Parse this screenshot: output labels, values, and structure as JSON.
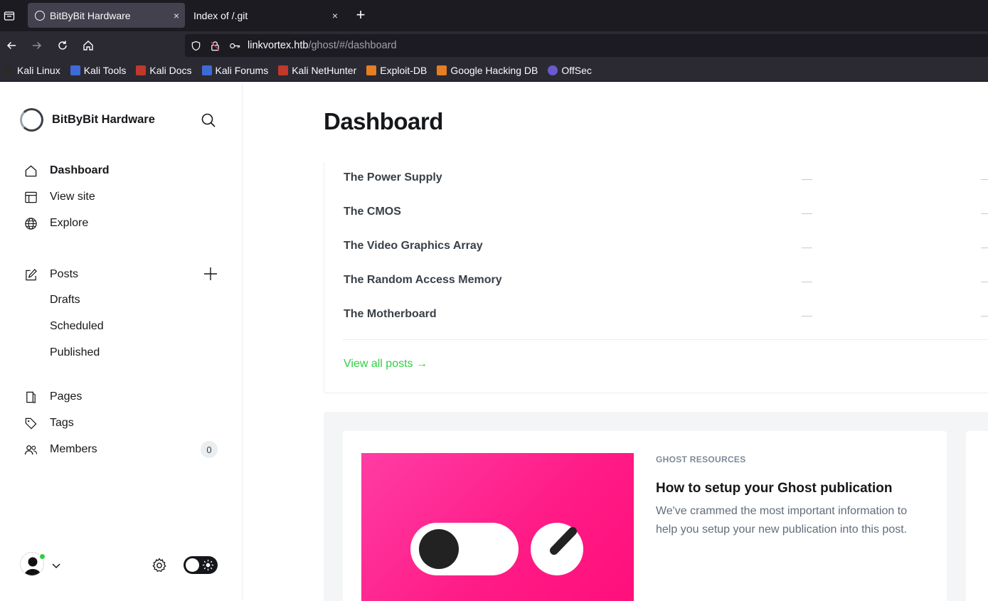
{
  "browser": {
    "tabs": [
      {
        "title": "BitByBit Hardware",
        "active": true
      },
      {
        "title": "Index of /.git",
        "active": false
      }
    ],
    "close_glyph": "×",
    "new_tab_glyph": "+",
    "url_host": "linkvortex.htb",
    "url_path": "/ghost/#/dashboard",
    "bookmarks": [
      {
        "label": "Kali Linux",
        "color": "#2a2a2a"
      },
      {
        "label": "Kali Tools",
        "color": "#3d6bd6"
      },
      {
        "label": "Kali Docs",
        "color": "#c0392b"
      },
      {
        "label": "Kali Forums",
        "color": "#3d6bd6"
      },
      {
        "label": "Kali NetHunter",
        "color": "#c0392b"
      },
      {
        "label": "Exploit-DB",
        "color": "#e67e22"
      },
      {
        "label": "Google Hacking DB",
        "color": "#e67e22"
      },
      {
        "label": "OffSec",
        "color": "#6a5acd"
      }
    ]
  },
  "sidebar": {
    "brand": "BitByBit Hardware",
    "nav": [
      {
        "label": "Dashboard",
        "icon": "home-icon"
      },
      {
        "label": "View site",
        "icon": "layout-icon"
      },
      {
        "label": "Explore",
        "icon": "globe-icon"
      }
    ],
    "posts": {
      "label": "Posts",
      "icon": "edit-icon"
    },
    "post_sub": [
      "Drafts",
      "Scheduled",
      "Published"
    ],
    "content": [
      {
        "label": "Pages",
        "icon": "page-icon"
      },
      {
        "label": "Tags",
        "icon": "tag-icon"
      },
      {
        "label": "Members",
        "icon": "members-icon"
      }
    ],
    "members_count": "0"
  },
  "main": {
    "title": "Dashboard",
    "posts": [
      "The Power Supply",
      "The CMOS",
      "The Video Graphics Array",
      "The Random Access Memory",
      "The Motherboard"
    ],
    "view_all": "View all posts →",
    "resources": {
      "tag": "GHOST RESOURCES",
      "title": "How to setup your Ghost publication",
      "desc": "We've crammed the most important information to help you setup your new publication into this post."
    }
  },
  "colors": {
    "accent": "#30cf43",
    "resource_image": "#ff1a85"
  }
}
